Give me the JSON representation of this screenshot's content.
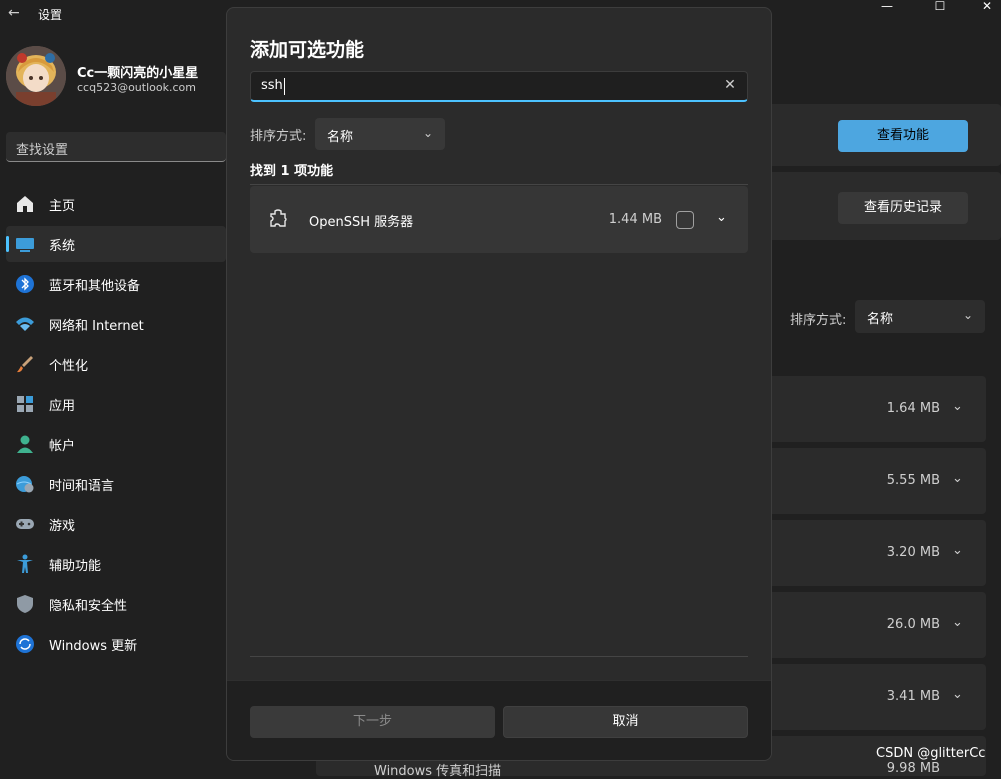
{
  "window": {
    "title": "设置",
    "minimize": "—",
    "maximize": "☐",
    "close": "✕"
  },
  "user": {
    "name": "Cc一颗闪亮的小星星",
    "email": "ccq523@outlook.com"
  },
  "search": {
    "placeholder": "查找设置"
  },
  "nav": [
    {
      "label": "主页",
      "icon": "home-icon"
    },
    {
      "label": "系统",
      "icon": "system-icon",
      "active": true
    },
    {
      "label": "蓝牙和其他设备",
      "icon": "bluetooth-icon"
    },
    {
      "label": "网络和 Internet",
      "icon": "wifi-icon"
    },
    {
      "label": "个性化",
      "icon": "brush-icon"
    },
    {
      "label": "应用",
      "icon": "apps-icon"
    },
    {
      "label": "帐户",
      "icon": "account-icon"
    },
    {
      "label": "时间和语言",
      "icon": "globe-clock-icon"
    },
    {
      "label": "游戏",
      "icon": "gamepad-icon"
    },
    {
      "label": "辅助功能",
      "icon": "accessibility-icon"
    },
    {
      "label": "隐私和安全性",
      "icon": "shield-icon"
    },
    {
      "label": "Windows 更新",
      "icon": "update-icon"
    }
  ],
  "background": {
    "view_features_label": "查看功能",
    "view_history_label": "查看历史记录",
    "sort_label": "排序方式:",
    "sort_value": "名称",
    "sizes": [
      "1.64 MB",
      "5.55 MB",
      "3.20 MB",
      "26.0 MB",
      "3.41 MB",
      "9.98 MB"
    ],
    "last_item": "Windows 传真和扫描",
    "watermark": "CSDN @glitterCc"
  },
  "dialog": {
    "title": "添加可选功能",
    "search_value": "ssh",
    "sort_label": "排序方式:",
    "sort_value": "名称",
    "found_text": "找到 1 项功能",
    "features": [
      {
        "name": "OpenSSH 服务器",
        "size": "1.44 MB",
        "checked": false
      }
    ],
    "next_label": "下一步",
    "cancel_label": "取消"
  },
  "colors": {
    "accent": "#4cc2ff",
    "accent_button": "#4da6e0",
    "background": "#202020",
    "dialog": "#2b2b2b"
  }
}
